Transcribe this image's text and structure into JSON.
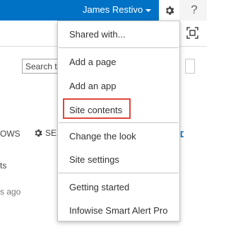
{
  "suite_bar": {
    "user_name": "James Restivo",
    "help_label": "?"
  },
  "page": {
    "search_partial": "Search th",
    "ribbon_partial_left": "OWS",
    "ribbon_partial_settings": "SE",
    "ribbon_partial_blue": "D",
    "content_partial_1": "ts",
    "content_partial_2": "s ago"
  },
  "settings_menu": {
    "items": [
      {
        "label": "Shared with..."
      },
      {
        "label": "Add a page"
      },
      {
        "label": "Add an app"
      },
      {
        "label": "Site contents",
        "highlighted": true
      },
      {
        "label": "Change the look"
      },
      {
        "label": "Site settings"
      },
      {
        "label": "Getting started"
      },
      {
        "label": "Infowise Smart Alert Pro"
      }
    ]
  },
  "colors": {
    "suite_bar_blue": "#0072c6",
    "highlight_border": "#e0463a"
  }
}
